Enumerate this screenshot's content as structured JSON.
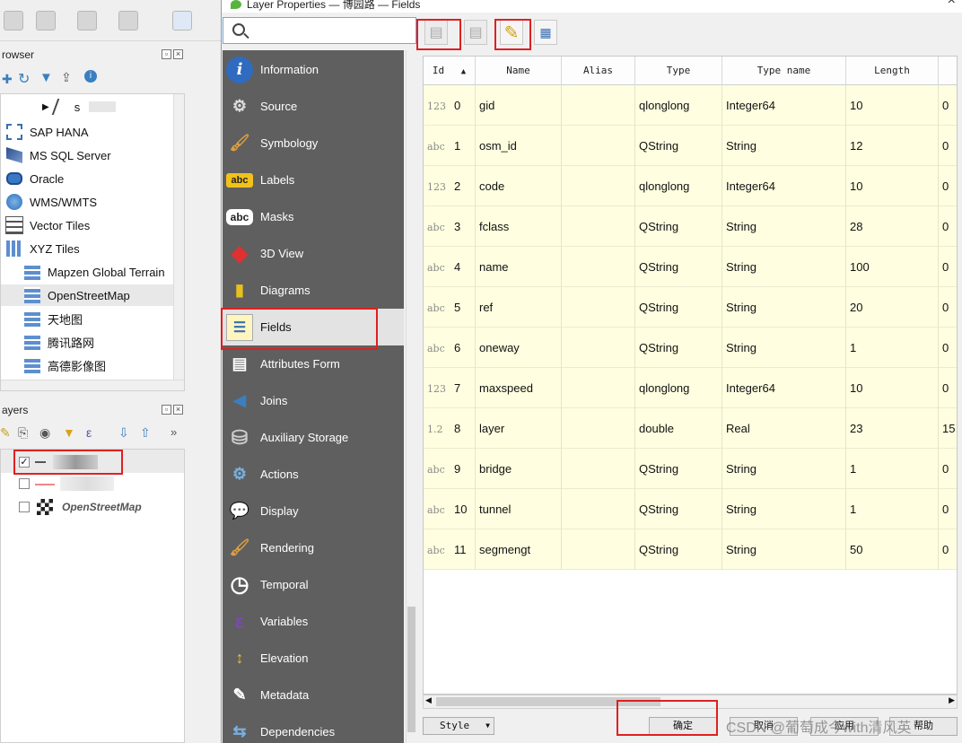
{
  "main": {
    "browser_title": "rowser",
    "layers_title": "ayers",
    "browser_items": [
      {
        "label": "s",
        "icon": "polyline-icon"
      },
      {
        "label": "SAP HANA",
        "icon": "database-dashed-icon"
      },
      {
        "label": "MS SQL Server",
        "icon": "mssql-icon"
      },
      {
        "label": "Oracle",
        "icon": "oracle-icon"
      },
      {
        "label": "WMS/WMTS",
        "icon": "globe-icon"
      },
      {
        "label": "Vector Tiles",
        "icon": "grid-icon"
      },
      {
        "label": "XYZ Tiles",
        "icon": "grid-icon"
      },
      {
        "label": "Mapzen Global Terrain",
        "icon": "tile-grid-icon"
      },
      {
        "label": "OpenStreetMap",
        "icon": "tile-grid-icon"
      },
      {
        "label": "天地图",
        "icon": "tile-grid-icon"
      },
      {
        "label": "腾讯路网",
        "icon": "tile-grid-icon"
      },
      {
        "label": "高德影像图",
        "icon": "tile-grid-icon"
      }
    ],
    "layers": [
      {
        "label": "",
        "checked": true
      },
      {
        "label": "",
        "checked": false
      },
      {
        "label": "OpenStreetMap",
        "checked": false
      }
    ]
  },
  "dialog": {
    "title": "Layer Properties — 博园路 — Fields",
    "close": "×",
    "nav": [
      {
        "label": "Information",
        "icon": "i"
      },
      {
        "label": "Source",
        "icon": "⚙"
      },
      {
        "label": "Symbology",
        "icon": "🖌"
      },
      {
        "label": "Labels",
        "icon": "abc"
      },
      {
        "label": "Masks",
        "icon": "abc"
      },
      {
        "label": "3D View",
        "icon": "◆"
      },
      {
        "label": "Diagrams",
        "icon": "▮"
      },
      {
        "label": "Fields",
        "icon": "☰"
      },
      {
        "label": "Attributes Form",
        "icon": "▤"
      },
      {
        "label": "Joins",
        "icon": "◀"
      },
      {
        "label": "Auxiliary Storage",
        "icon": "⛁"
      },
      {
        "label": "Actions",
        "icon": "⚙"
      },
      {
        "label": "Display",
        "icon": "💬"
      },
      {
        "label": "Rendering",
        "icon": "🖌"
      },
      {
        "label": "Temporal",
        "icon": "◷"
      },
      {
        "label": "Variables",
        "icon": "ε"
      },
      {
        "label": "Elevation",
        "icon": "↕"
      },
      {
        "label": "Metadata",
        "icon": "✎"
      },
      {
        "label": "Dependencies",
        "icon": "⇆"
      }
    ],
    "columns": [
      "Id",
      "Name",
      "Alias",
      "Type",
      "Type name",
      "Length"
    ],
    "rows": [
      {
        "icon": "123",
        "id": "0",
        "name": "gid",
        "alias": "",
        "type": "qlonglong",
        "type_name": "Integer64",
        "length": "10",
        "precision": "0"
      },
      {
        "icon": "abc",
        "id": "1",
        "name": "osm_id",
        "alias": "",
        "type": "QString",
        "type_name": "String",
        "length": "12",
        "precision": "0"
      },
      {
        "icon": "123",
        "id": "2",
        "name": "code",
        "alias": "",
        "type": "qlonglong",
        "type_name": "Integer64",
        "length": "10",
        "precision": "0"
      },
      {
        "icon": "abc",
        "id": "3",
        "name": "fclass",
        "alias": "",
        "type": "QString",
        "type_name": "String",
        "length": "28",
        "precision": "0"
      },
      {
        "icon": "abc",
        "id": "4",
        "name": "name",
        "alias": "",
        "type": "QString",
        "type_name": "String",
        "length": "100",
        "precision": "0"
      },
      {
        "icon": "abc",
        "id": "5",
        "name": "ref",
        "alias": "",
        "type": "QString",
        "type_name": "String",
        "length": "20",
        "precision": "0"
      },
      {
        "icon": "abc",
        "id": "6",
        "name": "oneway",
        "alias": "",
        "type": "QString",
        "type_name": "String",
        "length": "1",
        "precision": "0"
      },
      {
        "icon": "123",
        "id": "7",
        "name": "maxspeed",
        "alias": "",
        "type": "qlonglong",
        "type_name": "Integer64",
        "length": "10",
        "precision": "0"
      },
      {
        "icon": "1.2",
        "id": "8",
        "name": "layer",
        "alias": "",
        "type": "double",
        "type_name": "Real",
        "length": "23",
        "precision": "15"
      },
      {
        "icon": "abc",
        "id": "9",
        "name": "bridge",
        "alias": "",
        "type": "QString",
        "type_name": "String",
        "length": "1",
        "precision": "0"
      },
      {
        "icon": "abc",
        "id": "10",
        "name": "tunnel",
        "alias": "",
        "type": "QString",
        "type_name": "String",
        "length": "1",
        "precision": "0"
      },
      {
        "icon": "abc",
        "id": "11",
        "name": "segmengt",
        "alias": "",
        "type": "QString",
        "type_name": "String",
        "length": "50",
        "precision": "0"
      }
    ],
    "buttons": {
      "style": "Style",
      "ok": "确定",
      "cancel": "取消",
      "apply": "应用",
      "help": "帮助"
    },
    "watermark": "CSDN @葡萄成今with清风英"
  },
  "colors": {
    "nav_bg": "#5f5f5f",
    "row_bg": "#fffee0",
    "highlight": "#e02020"
  }
}
